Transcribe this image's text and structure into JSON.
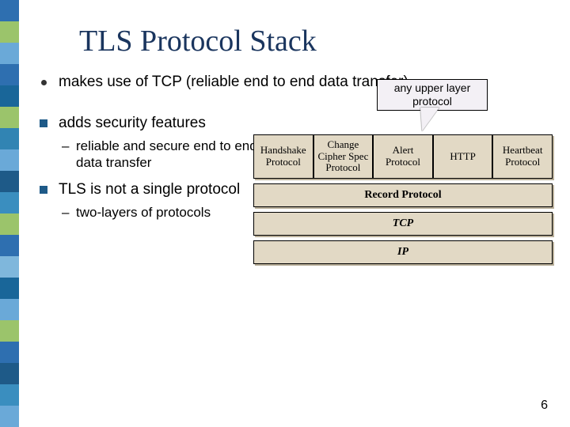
{
  "title": "TLS Protocol Stack",
  "bullets": {
    "b1": "makes use of TCP (reliable end to end data transfer)",
    "b2": "adds security features",
    "b2_sub": "reliable and secure end to end data transfer",
    "b3": "TLS is not a single protocol",
    "b3_sub": "two-layers of protocols"
  },
  "callout": "any upper layer protocol",
  "diagram": {
    "row1": {
      "c1": "Handshake Protocol",
      "c2": "Change Cipher Spec Protocol",
      "c3": "Alert Protocol",
      "c4": "HTTP",
      "c5": "Heartbeat Protocol"
    },
    "row2": "Record Protocol",
    "row3": "TCP",
    "row4": "IP"
  },
  "page_number": "6"
}
